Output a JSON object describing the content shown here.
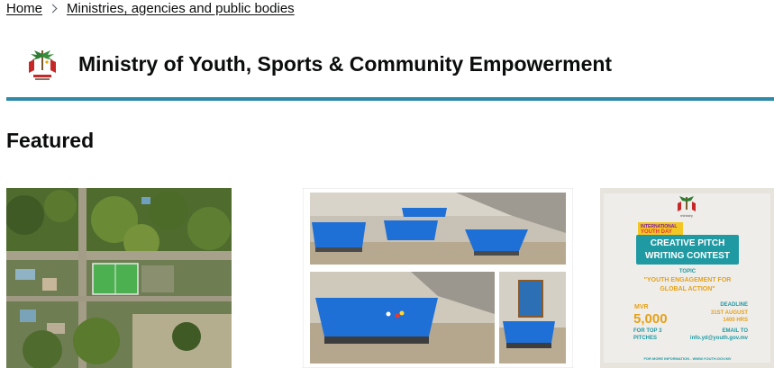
{
  "breadcrumb": {
    "items": [
      "Home",
      "Ministries, agencies and public bodies"
    ]
  },
  "organisation": {
    "title": "Ministry of Youth, Sports & Community Empowerment",
    "accent_color": "#2e8aa8"
  },
  "featured": {
    "heading": "Featured",
    "cards": [
      {
        "image": "aerial-view-of-sports-field"
      },
      {
        "image": "billiards-hall-renderings"
      },
      {
        "image": "creative-pitch-writing-contest-poster",
        "poster": {
          "badge_top": "INTERNATIONAL",
          "badge_bottom": "YOUTH DAY",
          "title_line1": "CREATIVE PITCH",
          "title_line2": "WRITING CONTEST",
          "topic_label": "TOPIC",
          "topic_line1": "\"YOUTH ENGAGEMENT FOR",
          "topic_line2": "GLOBAL ACTION\"",
          "prize_currency": "MVR",
          "prize_amount": "5,000",
          "prize_note_line1": "FOR TOP 3",
          "prize_note_line2": "PITCHES",
          "deadline_label": "DEADLINE",
          "deadline_date": "31ST AUGUST",
          "deadline_time": "1400 HRS",
          "email_label": "EMAIL TO",
          "email": "info.yd@youth.gov.mv",
          "footer": "FOR MORE INFORMATION - WWW.YOUTH.GOV.MV"
        }
      }
    ]
  }
}
